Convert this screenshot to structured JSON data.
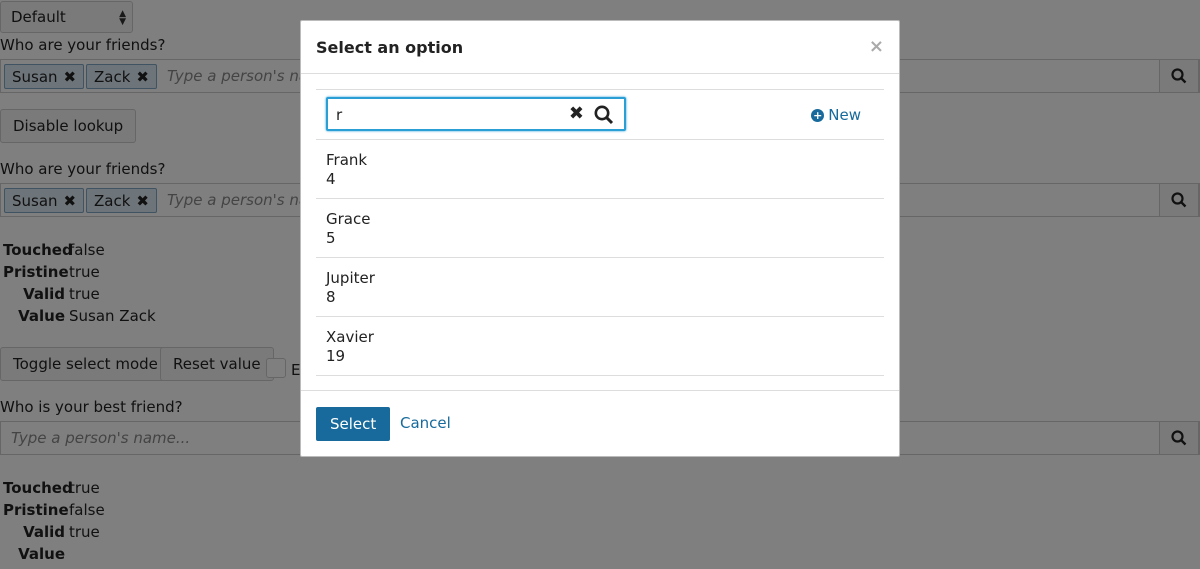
{
  "background": {
    "mode_select": "Default",
    "q1_label": "Who are your friends?",
    "chips": [
      "Susan",
      "Zack"
    ],
    "chip_remove": "✖",
    "placeholder": "Type a person's name...",
    "disable_lookup": "Disable lookup",
    "q2_label": "Who are your friends?",
    "state1": [
      {
        "k": "Touched",
        "v": "false"
      },
      {
        "k": "Pristine",
        "v": "true"
      },
      {
        "k": "Valid",
        "v": "true"
      },
      {
        "k": "Value",
        "v": "Susan Zack"
      }
    ],
    "toggle_select_mode": "Toggle select mode",
    "reset_value": "Reset value",
    "checkbox_label_partial": "E",
    "q3_label": "Who is your best friend?",
    "state2": [
      {
        "k": "Touched",
        "v": "true"
      },
      {
        "k": "Pristine",
        "v": "false"
      },
      {
        "k": "Valid",
        "v": "true"
      },
      {
        "k": "Value",
        "v": ""
      }
    ]
  },
  "modal": {
    "title": "Select an option",
    "close": "×",
    "search_value": "r",
    "clear": "✖",
    "new_label": "New",
    "results": [
      {
        "name": "Frank",
        "id": "4"
      },
      {
        "name": "Grace",
        "id": "5"
      },
      {
        "name": "Jupiter",
        "id": "8"
      },
      {
        "name": "Xavier",
        "id": "19"
      }
    ],
    "select_button": "Select",
    "cancel_link": "Cancel"
  },
  "colors": {
    "accent": "#176a9b",
    "focus": "#2a9fd6",
    "chip_bg": "#dceaf5",
    "overlay": "rgba(0,0,0,0.5)"
  },
  "icons": {
    "search": "search-icon",
    "clear": "close-icon",
    "plus": "plus-circle-icon"
  }
}
